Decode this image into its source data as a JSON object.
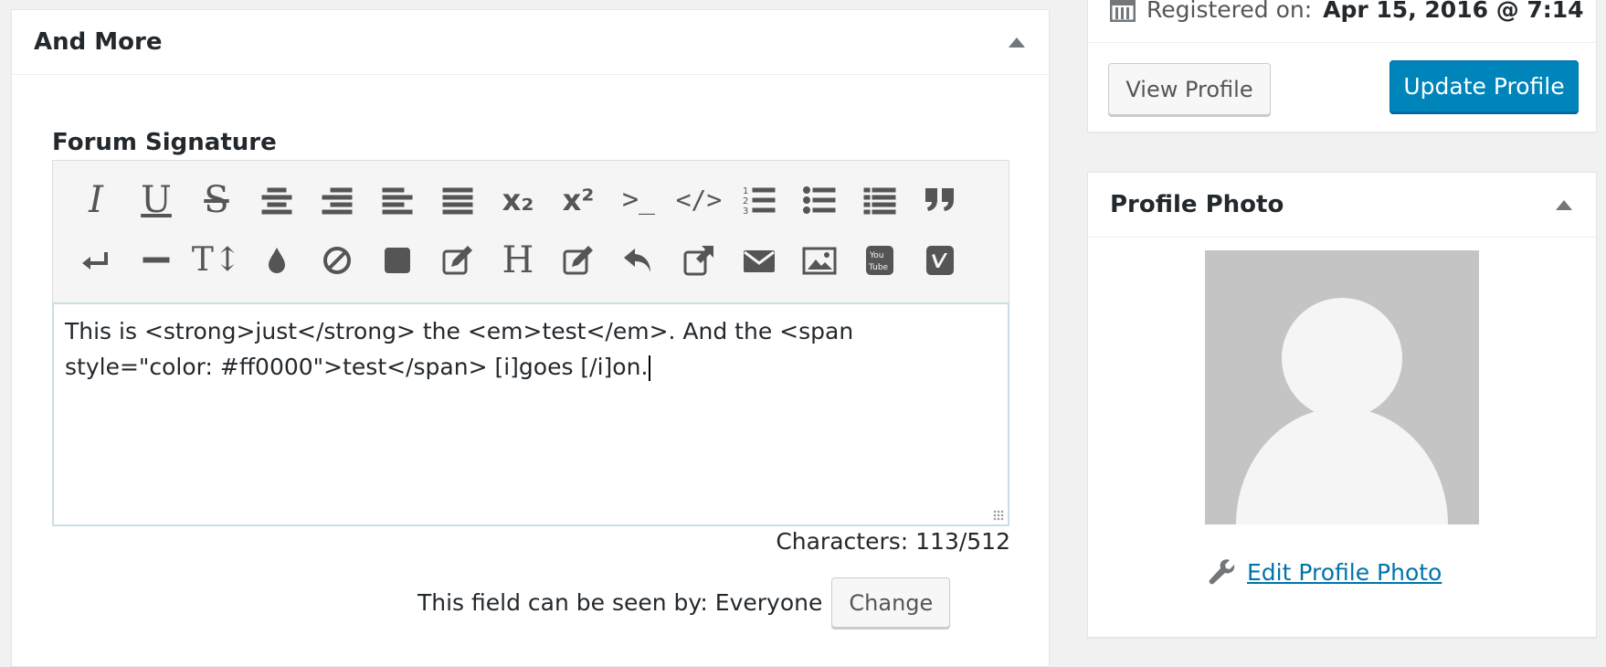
{
  "main_box": {
    "title": "And More",
    "field_label": "Forum Signature",
    "editor_text": "This is <strong>just</strong> the <em>test</em>. And the <span style=\"color: #ff0000\">test</span> [i]goes [/i]on.",
    "char_count": "Characters: 113/512",
    "visibility_text": "This field can be seen by: Everyone",
    "change_label": "Change",
    "toolbar": {
      "subscript": "x₂",
      "superscript": "x²",
      "terminal": ">_",
      "code": "</>",
      "heading": "H"
    }
  },
  "sidebar": {
    "registered_label": "Registered on:",
    "registered_value": "Apr 15, 2016 @ 7:14",
    "view_profile": "View Profile",
    "update_profile": "Update Profile",
    "photo_title": "Profile Photo",
    "edit_photo": "Edit Profile Photo"
  },
  "colors": {
    "primary": "#0085ba",
    "link": "#0073aa",
    "icon": "#555555",
    "placeholder_avatar": "#c4c4c4"
  }
}
